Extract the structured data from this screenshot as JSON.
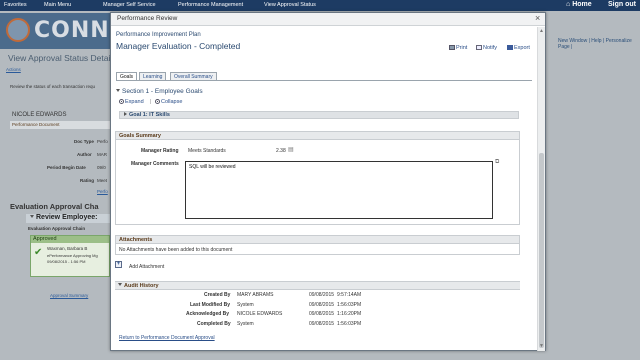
{
  "topbar": {
    "favorites": "Favorites",
    "main_menu": "Main Menu",
    "manager_self_service": "Manager Self Service",
    "performance_management": "Performance Management",
    "view_approval_status": "View Approval Status",
    "home": "Home",
    "sign_out": "Sign out"
  },
  "background": {
    "logo_text": "CONNE",
    "page_title": "View Approval Status Detai",
    "actions": "Actions",
    "instructions": "Review the status of each transaction requ",
    "employee_name": "NICOLE EDWARDS",
    "document_label": "Performance Document",
    "fields": [
      {
        "label": "Doc Type",
        "value": "Perfo"
      },
      {
        "label": "Author",
        "value": "MAR"
      },
      {
        "label": "Period Begin Date",
        "value": "09/0"
      },
      {
        "label": "Rating",
        "value": "Meet"
      },
      {
        "label": "",
        "value": "Perfo"
      }
    ],
    "chart_title": "Evaluation Approval Cha",
    "review_employee": "Review Employee:",
    "chain_label": "Evaluation Approval Chain",
    "approved": "Approved",
    "approver_name": "Waxman, Barbara B",
    "approver_role": "ePerformance Approving Mg",
    "approver_date": "09/08/2015 - 1:56 PM",
    "approval_summary": "Approval Summary",
    "top_links": "New Window | Help | Personalize Page |"
  },
  "modal": {
    "title": "Performance Review",
    "close": "×",
    "plan_title": "Performance Improvement Plan",
    "heading": "Manager Evaluation - Completed",
    "actions": {
      "print": "Print",
      "notify": "Notify",
      "export": "Export"
    },
    "tabs": [
      "Goals",
      "Learning",
      "Overall Summary"
    ],
    "section1": "Section 1 - Employee Goals",
    "expand": "Expand",
    "collapse": "Collapse",
    "goal1": "Goal 1: IT Skills",
    "goals_summary": {
      "header": "Goals Summary",
      "manager_rating_label": "Manager Rating",
      "manager_rating_value": "Meets Standards",
      "manager_rating_score": "2.38",
      "manager_comments_label": "Manager Comments",
      "manager_comments_value": "SQL will be reviewed"
    },
    "attachments": {
      "header": "Attachments",
      "empty_text": "No Attachments have been added to this document",
      "add_label": "Add Attachment"
    },
    "audit_history": {
      "header": "Audit History",
      "rows": [
        {
          "label": "Created By",
          "name": "MARY ABRAMS",
          "date": "09/08/2015",
          "time": "9:57:14AM"
        },
        {
          "label": "Last Modified By",
          "name": "System",
          "date": "09/08/2015",
          "time": "1:56:03PM"
        },
        {
          "label": "Acknowledged By",
          "name": "NICOLE EDWARDS",
          "date": "09/08/2015",
          "time": "1:16:20PM"
        },
        {
          "label": "Completed By",
          "name": "System",
          "date": "09/08/2015",
          "time": "1:56:03PM"
        }
      ]
    },
    "return_link": "Return to Performance Document Approval"
  }
}
